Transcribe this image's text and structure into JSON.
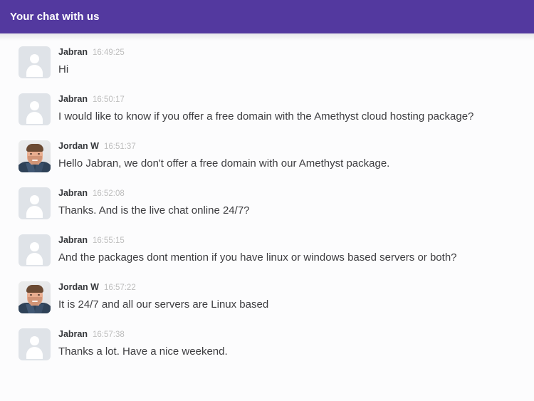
{
  "header": {
    "title": "Your chat with us",
    "background_color": "#53399f",
    "title_color": "#ffffff"
  },
  "colors": {
    "accent": "#53399f",
    "page_background": "#fcfcfd",
    "avatar_placeholder": "#dfe3e8",
    "author_text": "#35373b",
    "timestamp_text": "#bdbdbd",
    "message_text": "#3d3d40"
  },
  "conversation": {
    "messages": [
      {
        "author": "Jabran",
        "time": "16:49:25",
        "text": "Hi",
        "avatar": "avatar-placeholder-icon"
      },
      {
        "author": "Jabran",
        "time": "16:50:17",
        "text": "I would like to know if you offer a free domain with the Amethyst cloud hosting package?",
        "avatar": "avatar-placeholder-icon"
      },
      {
        "author": "Jordan W",
        "time": "16:51:37",
        "text": "Hello Jabran, we don't offer a free domain with our Amethyst package.",
        "avatar": "avatar-photo-jordan"
      },
      {
        "author": "Jabran",
        "time": "16:52:08",
        "text": "Thanks. And is the live chat online 24/7?",
        "avatar": "avatar-placeholder-icon"
      },
      {
        "author": "Jabran",
        "time": "16:55:15",
        "text": "And the packages dont mention if you have linux or windows based servers or both?",
        "avatar": "avatar-placeholder-icon"
      },
      {
        "author": "Jordan W",
        "time": "16:57:22",
        "text": "It is 24/7 and all our servers are Linux based",
        "avatar": "avatar-photo-jordan"
      },
      {
        "author": "Jabran",
        "time": "16:57:38",
        "text": "Thanks a lot. Have a nice weekend.",
        "avatar": "avatar-placeholder-icon"
      }
    ]
  }
}
